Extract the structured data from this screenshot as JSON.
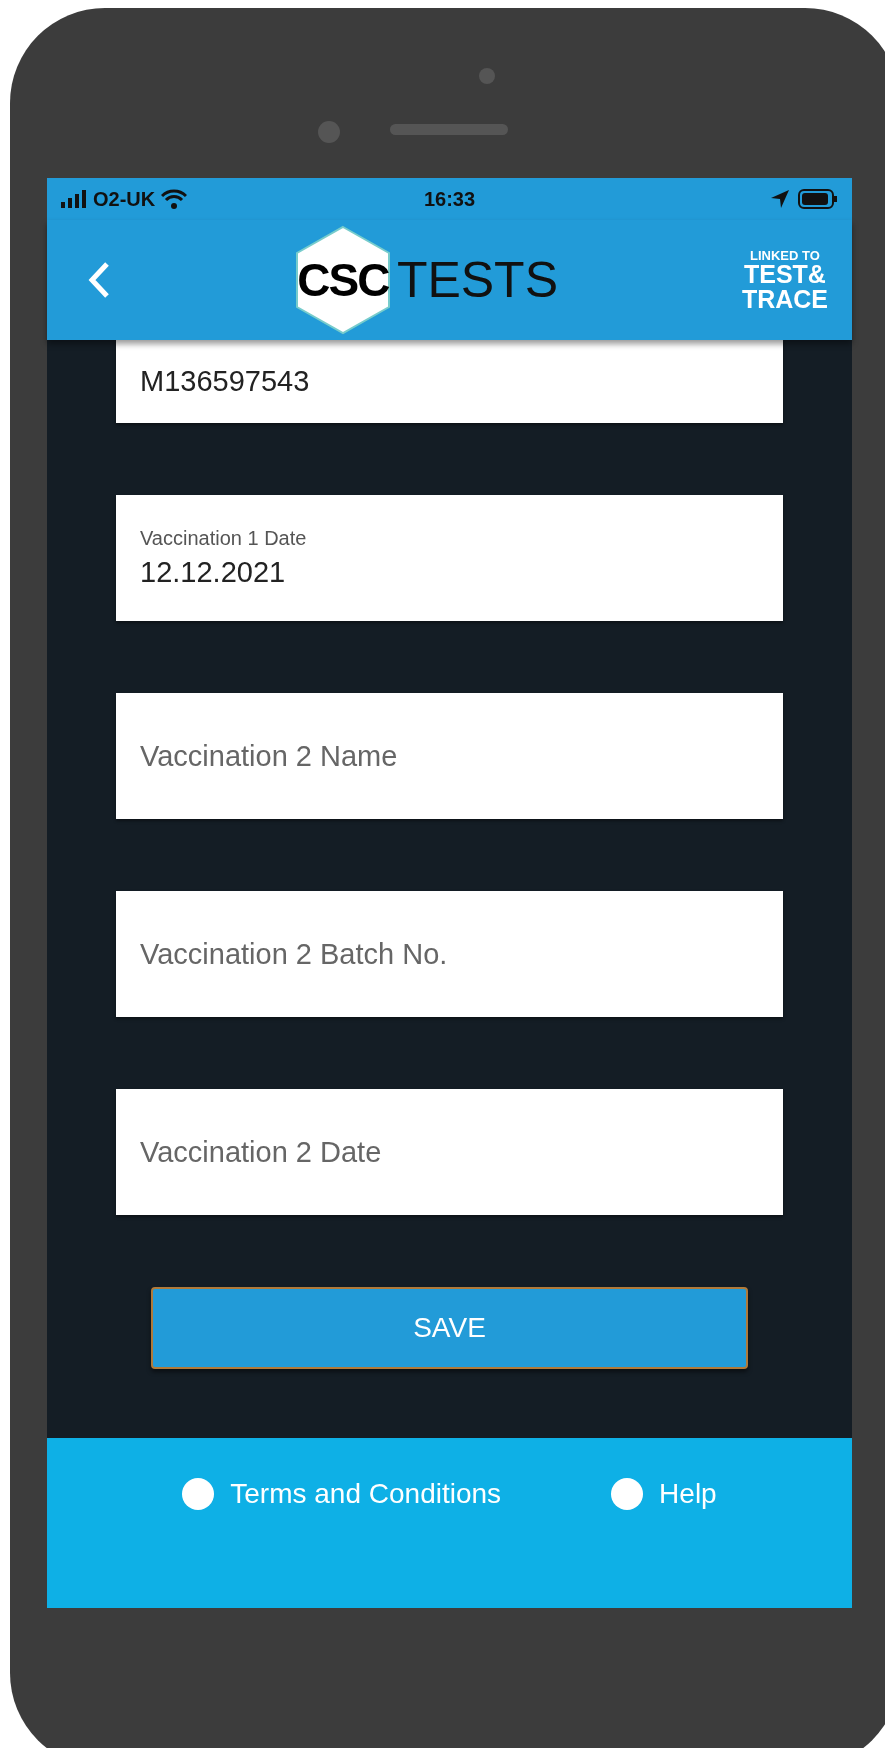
{
  "status_bar": {
    "carrier": "O2-UK",
    "time": "16:33"
  },
  "header": {
    "logo_mark": "CSC",
    "logo_text": "TESTS",
    "badge_top": "LINKED TO",
    "badge_main": "TEST&",
    "badge_bottom": "TRACE"
  },
  "fields": [
    {
      "kind": "value",
      "value": "M136597543"
    },
    {
      "kind": "labeled",
      "label": "Vaccination 1 Date",
      "value": "12.12.2021"
    },
    {
      "kind": "empty",
      "placeholder": "Vaccination 2 Name"
    },
    {
      "kind": "empty",
      "placeholder": "Vaccination 2 Batch No."
    },
    {
      "kind": "empty",
      "placeholder": "Vaccination 2 Date"
    }
  ],
  "save_button": "SAVE",
  "footer": {
    "links": [
      "Terms and Conditions",
      "Help"
    ]
  }
}
